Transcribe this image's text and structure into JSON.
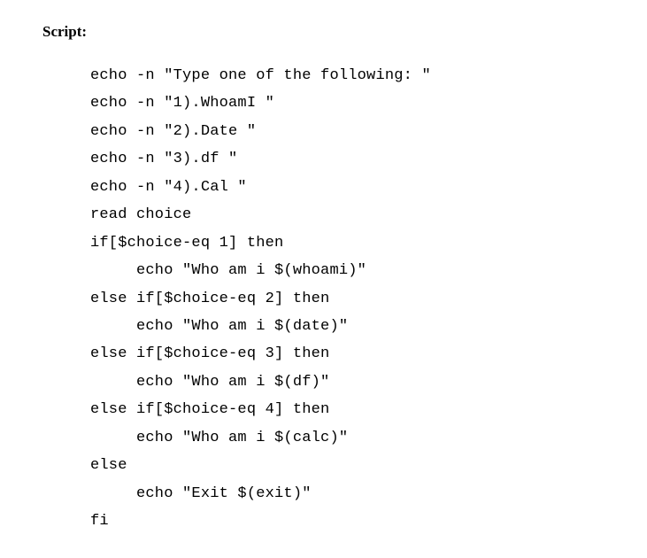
{
  "heading": "Script:",
  "code": {
    "lines": [
      "echo -n \"Type one of the following: \"",
      "echo -n \"1).WhoamI \"",
      "echo -n \"2).Date \"",
      "echo -n \"3).df \"",
      "echo -n \"4).Cal \"",
      "read choice",
      "if[$choice-eq 1] then",
      "     echo \"Who am i $(whoami)\"",
      "else if[$choice-eq 2] then",
      "     echo \"Who am i $(date)\"",
      "else if[$choice-eq 3] then",
      "     echo \"Who am i $(df)\"",
      "else if[$choice-eq 4] then",
      "     echo \"Who am i $(calc)\"",
      "else",
      "     echo \"Exit $(exit)\"",
      "fi"
    ]
  }
}
